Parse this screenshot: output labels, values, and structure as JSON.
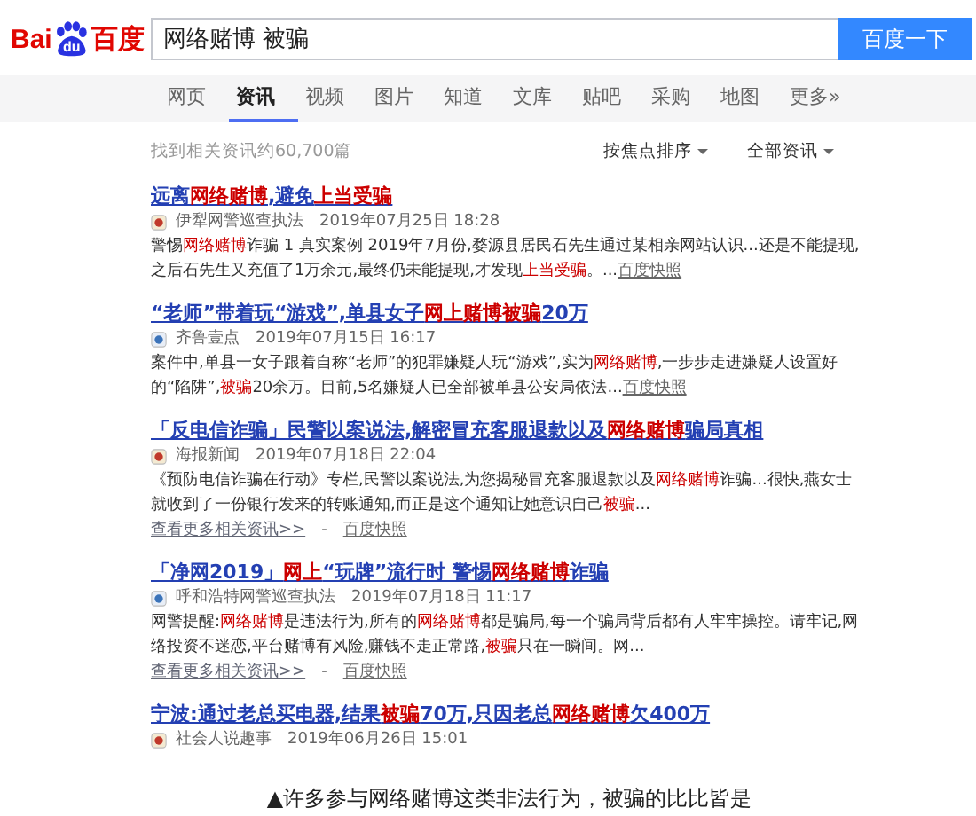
{
  "logo": {
    "left": "Bai",
    "paw": "du",
    "right": "百度"
  },
  "search": {
    "value": "网络赌博 被骗",
    "button": "百度一下"
  },
  "tabs": [
    {
      "label": "网页",
      "selected": false
    },
    {
      "label": "资讯",
      "selected": true
    },
    {
      "label": "视频",
      "selected": false
    },
    {
      "label": "图片",
      "selected": false
    },
    {
      "label": "知道",
      "selected": false
    },
    {
      "label": "文库",
      "selected": false
    },
    {
      "label": "贴吧",
      "selected": false
    },
    {
      "label": "采购",
      "selected": false
    },
    {
      "label": "地图",
      "selected": false
    },
    {
      "label": "更多»",
      "selected": false
    }
  ],
  "result_count": "找到相关资讯约60,700篇",
  "sort": "按焦点排序",
  "filter": "全部资讯",
  "results": [
    {
      "title": [
        {
          "t": "远离",
          "hl": false
        },
        {
          "t": "网络赌博",
          "hl": true
        },
        {
          "t": ",避免",
          "hl": false
        },
        {
          "t": "上当受骗",
          "hl": true
        }
      ],
      "source": "伊犁网警巡查执法",
      "time": "2019年07月25日 18:28",
      "snippet": [
        {
          "t": "警惕",
          "hl": false
        },
        {
          "t": "网络赌博",
          "hl": true
        },
        {
          "t": "诈骗 1 真实案例 2019年7月份,婺源县居民石先生通过某相亲网站认识...还是不能提现,之后石先生又充值了1万余元,最终仍未能提现,才发现",
          "hl": false
        },
        {
          "t": "上当受骗",
          "hl": true
        },
        {
          "t": "。...",
          "hl": false
        }
      ],
      "snapshot": "百度快照"
    },
    {
      "title": [
        {
          "t": "“老师”带着玩“游戏”,单县女子",
          "hl": false
        },
        {
          "t": "网上赌博被骗",
          "hl": true
        },
        {
          "t": "20万",
          "hl": false
        }
      ],
      "source": "齐鲁壹点",
      "time": "2019年07月15日 16:17",
      "snippet": [
        {
          "t": "案件中,单县一女子跟着自称“老师”的犯罪嫌疑人玩“游戏”,实为",
          "hl": false
        },
        {
          "t": "网络赌博",
          "hl": true
        },
        {
          "t": ",一步步走进嫌疑人设置好的“陷阱”,",
          "hl": false
        },
        {
          "t": "被骗",
          "hl": true
        },
        {
          "t": "20余万。目前,5名嫌疑人已全部被单县公安局依法...",
          "hl": false
        }
      ],
      "snapshot": "百度快照"
    },
    {
      "title": [
        {
          "t": "「反电信诈骗」民警以案说法,解密冒充客服退款以及",
          "hl": false
        },
        {
          "t": "网络赌博",
          "hl": true
        },
        {
          "t": "骗局真相",
          "hl": false
        }
      ],
      "source": "海报新闻",
      "time": "2019年07月18日 22:04",
      "snippet": [
        {
          "t": "《预防电信诈骗在行动》专栏,民警以案说法,为您揭秘冒充客服退款以及",
          "hl": false
        },
        {
          "t": "网络赌博",
          "hl": true
        },
        {
          "t": "诈骗...很快,燕女士就收到了一份银行发来的转账通知,而正是这个通知让她意识自己",
          "hl": false
        },
        {
          "t": "被骗",
          "hl": true
        },
        {
          "t": "...",
          "hl": false
        }
      ],
      "more": "查看更多相关资讯>>",
      "separator": "-",
      "snapshot": "百度快照"
    },
    {
      "title": [
        {
          "t": "「净网2019」",
          "hl": false
        },
        {
          "t": "网上",
          "hl": true
        },
        {
          "t": "“玩牌”流行时 警惕",
          "hl": false
        },
        {
          "t": "网络赌博",
          "hl": true
        },
        {
          "t": "诈骗",
          "hl": false
        }
      ],
      "source": "呼和浩特网警巡查执法",
      "time": "2019年07月18日 11:17",
      "snippet": [
        {
          "t": "网警提醒:",
          "hl": false
        },
        {
          "t": "网络赌博",
          "hl": true
        },
        {
          "t": "是违法行为,所有的",
          "hl": false
        },
        {
          "t": "网络赌博",
          "hl": true
        },
        {
          "t": "都是骗局,每一个骗局背后都有人牢牢操控。请牢记,网络投资不迷恋,平台赌博有风险,赚钱不走正常路,",
          "hl": false
        },
        {
          "t": "被骗",
          "hl": true
        },
        {
          "t": "只在一瞬间。网...",
          "hl": false
        }
      ],
      "more": "查看更多相关资讯>>",
      "separator": "-",
      "snapshot": "百度快照"
    },
    {
      "title": [
        {
          "t": "宁波:通过老总买电器,结果",
          "hl": false
        },
        {
          "t": "被骗",
          "hl": true
        },
        {
          "t": "70万,只因老总",
          "hl": false
        },
        {
          "t": "网络赌博",
          "hl": true
        },
        {
          "t": "欠400万",
          "hl": false
        }
      ],
      "source": "社会人说趣事",
      "time": "2019年06月26日 15:01"
    }
  ],
  "caption": "▲许多参与网络赌博这类非法行为，被骗的比比皆是"
}
